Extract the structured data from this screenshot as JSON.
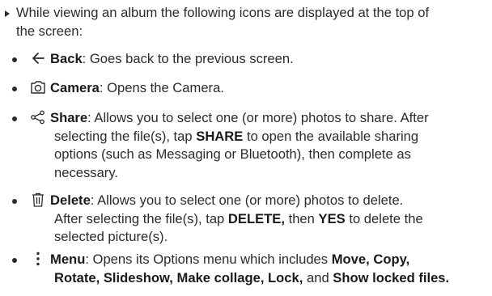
{
  "intro": {
    "text_line1": "While viewing an album the following icons are displayed at the top of",
    "text_line2": "the screen:"
  },
  "items": [
    {
      "icon": "back-arrow-icon",
      "term": "Back",
      "desc": ": Goes back to the previous screen."
    },
    {
      "icon": "camera-icon",
      "term": "Camera",
      "desc": ": Opens the Camera."
    },
    {
      "icon": "share-icon",
      "term": "Share",
      "desc_a": ": Allows you to select one (or more) photos to share. After",
      "desc_b": "selecting the file(s), tap ",
      "kw1": "SHARE",
      "desc_c": " to open the available sharing",
      "desc_d": "options (such as Messaging or Bluetooth), then complete as",
      "desc_e": "necessary."
    },
    {
      "icon": "trash-icon",
      "term": "Delete",
      "desc_a": ": Allows you to select one (or more) photos to delete.",
      "desc_b": "After selecting the file(s), tap ",
      "kw1": "DELETE,",
      "desc_c": " then ",
      "kw2": "YES",
      "desc_d": " to delete the",
      "desc_e": "selected picture(s)."
    },
    {
      "icon": "more-vertical-icon",
      "term": "Menu",
      "desc_a": ": Opens its Options menu which includes ",
      "kw1": "Move, Copy,",
      "kw2": "Rotate, Slideshow, Make collage, Lock,",
      "desc_b": " and ",
      "kw3": "Show locked files."
    }
  ]
}
